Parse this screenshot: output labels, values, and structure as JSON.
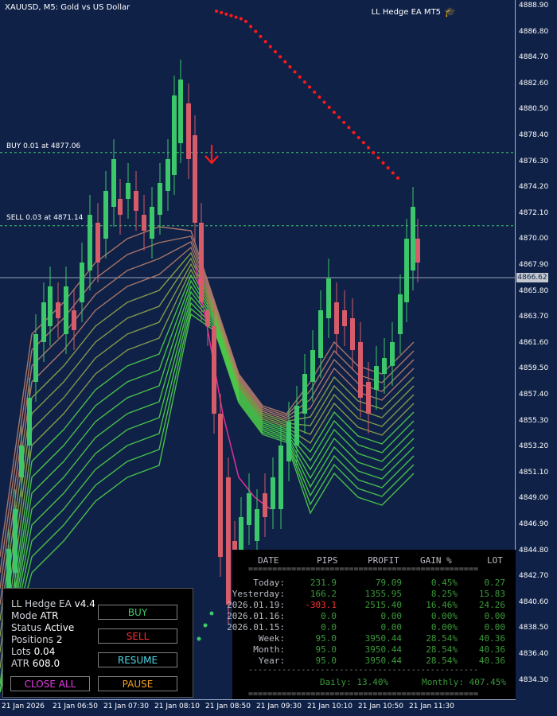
{
  "chart": {
    "symbol": "XAUUSD, M5:  Gold vs US Dollar",
    "brand": "LL Hedge EA MT5",
    "current_price": "4866.62",
    "y_ticks": [
      "4888.90",
      "4886.80",
      "4884.70",
      "4882.60",
      "4880.50",
      "4878.40",
      "4876.30",
      "4874.20",
      "4872.10",
      "4870.00",
      "4867.90",
      "4865.80",
      "4863.70",
      "4861.60",
      "4859.50",
      "4857.40",
      "4855.30",
      "4853.20",
      "4851.10",
      "4849.00",
      "4846.90",
      "4844.80",
      "4842.70",
      "4840.60",
      "4838.50",
      "4836.40",
      "4834.30"
    ],
    "x_ticks": [
      "21 Jan 2026",
      "21 Jan 06:50",
      "21 Jan 07:30",
      "21 Jan 08:10",
      "21 Jan 08:50",
      "21 Jan 09:30",
      "21 Jan 10:10",
      "21 Jan 10:50",
      "21 Jan 11:30"
    ],
    "buy_line_label": "BUY 0.01 at 4877.06",
    "sell_line_label": "SELL 0.03 at 4871.14",
    "buy_price": 4877.06,
    "sell_price": 4871.14,
    "colors": {
      "background": "#0f2147",
      "bull": "#3cc86a",
      "bear": "#d65c6a",
      "dots": "#ff1a1a"
    }
  },
  "ea_panel": {
    "title": "LL Hedge EA",
    "version": "v4.4",
    "mode_label": "Mode",
    "mode_value": "ATR",
    "status_label": "Status",
    "status_value": "Active",
    "positions_label": "Positions",
    "positions_value": "2",
    "lots_label": "Lots",
    "lots_value": "0.04",
    "atr_label": "ATR",
    "atr_value": "608.0",
    "buttons": {
      "buy": "BUY",
      "sell": "SELL",
      "resume": "RESUME",
      "close_all": "CLOSE ALL",
      "pause": "PAUSE"
    }
  },
  "stats": {
    "headers": [
      "DATE",
      "PIPS",
      "PROFIT",
      "GAIN %",
      "LOT"
    ],
    "separator": "================================================",
    "separator2": "------------------------------------------------",
    "rows": [
      {
        "date": "Today:",
        "pips": "231.9",
        "profit": "79.09",
        "gain": "0.45%",
        "lot": "0.27"
      },
      {
        "date": "Yesterday:",
        "pips": "166.2",
        "profit": "1355.95",
        "gain": "8.25%",
        "lot": "15.83"
      },
      {
        "date": "2026.01.19:",
        "pips": "-303.1",
        "profit": "2515.40",
        "gain": "16.46%",
        "lot": "24.26"
      },
      {
        "date": "2026.01.16:",
        "pips": "0.0",
        "profit": "0.00",
        "gain": "0.00%",
        "lot": "0.00"
      },
      {
        "date": "2026.01.15:",
        "pips": "0.0",
        "profit": "0.00",
        "gain": "0.00%",
        "lot": "0.00"
      },
      {
        "date": "Week:",
        "pips": "95.0",
        "profit": "3950.44",
        "gain": "28.54%",
        "lot": "40.36"
      },
      {
        "date": "Month:",
        "pips": "95.0",
        "profit": "3950.44",
        "gain": "28.54%",
        "lot": "40.36"
      },
      {
        "date": "Year:",
        "pips": "95.0",
        "profit": "3950.44",
        "gain": "28.54%",
        "lot": "40.36"
      }
    ],
    "daily": "Daily: 13.40%",
    "monthly": "Monthly: 407.45%"
  }
}
